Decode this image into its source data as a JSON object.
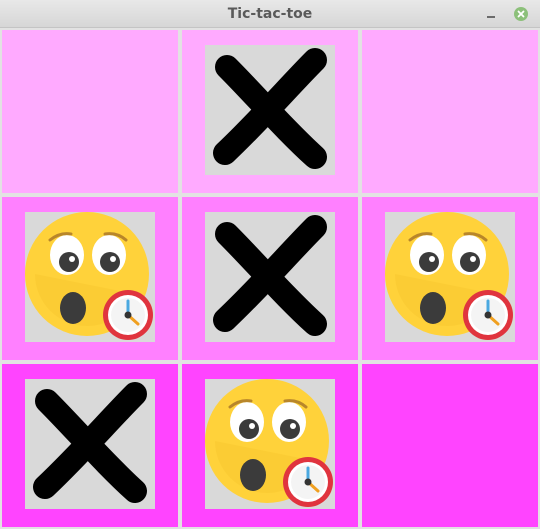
{
  "window": {
    "title": "Tic-tac-toe",
    "minimize_icon": "minimize-icon",
    "close_icon": "close-icon"
  },
  "colors": {
    "row1": "#ffaaff",
    "row2": "#ff80ff",
    "row3": "#ff44ff",
    "piece_bg": "#d9d9d9",
    "x_mark": "#000000",
    "emoji_face": "#ffd23a",
    "clock_ring": "#e0343e"
  },
  "board": {
    "cells": [
      {
        "row": 1,
        "col": 1,
        "mark": "empty"
      },
      {
        "row": 1,
        "col": 2,
        "mark": "x-mark-icon"
      },
      {
        "row": 1,
        "col": 3,
        "mark": "empty"
      },
      {
        "row": 2,
        "col": 1,
        "mark": "surprised-emoji-clock-icon"
      },
      {
        "row": 2,
        "col": 2,
        "mark": "x-mark-icon"
      },
      {
        "row": 2,
        "col": 3,
        "mark": "surprised-emoji-clock-icon"
      },
      {
        "row": 3,
        "col": 1,
        "mark": "x-mark-icon"
      },
      {
        "row": 3,
        "col": 2,
        "mark": "surprised-emoji-clock-icon"
      },
      {
        "row": 3,
        "col": 3,
        "mark": "empty"
      }
    ]
  }
}
